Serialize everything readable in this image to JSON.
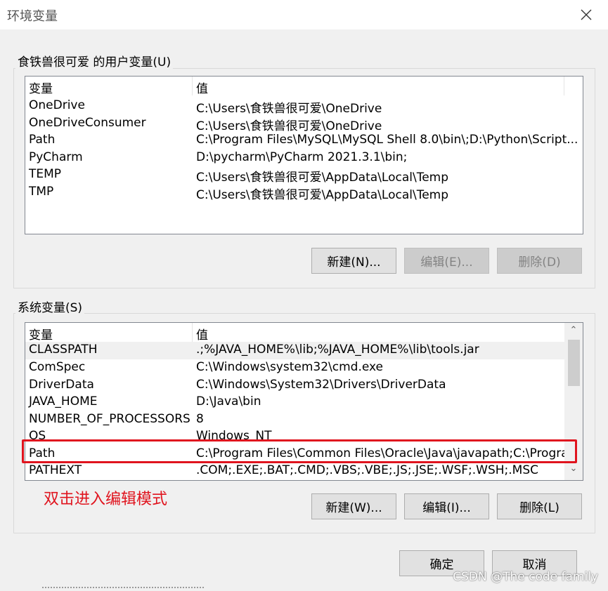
{
  "window": {
    "title": "环境变量"
  },
  "user_vars": {
    "group_label": "食铁兽很可爱 的用户变量(U)",
    "col_name": "变量",
    "col_value": "值",
    "rows": [
      {
        "name": "OneDrive",
        "value": "C:\\Users\\食铁兽很可爱\\OneDrive"
      },
      {
        "name": "OneDriveConsumer",
        "value": "C:\\Users\\食铁兽很可爱\\OneDrive"
      },
      {
        "name": "Path",
        "value": "C:\\Program Files\\MySQL\\MySQL Shell 8.0\\bin\\;D:\\Python\\Script..."
      },
      {
        "name": "PyCharm",
        "value": "D:\\pycharm\\PyCharm 2021.3.1\\bin;"
      },
      {
        "name": "TEMP",
        "value": "C:\\Users\\食铁兽很可爱\\AppData\\Local\\Temp"
      },
      {
        "name": "TMP",
        "value": "C:\\Users\\食铁兽很可爱\\AppData\\Local\\Temp"
      }
    ],
    "buttons": {
      "new": "新建(N)...",
      "edit": "编辑(E)...",
      "delete": "删除(D)"
    }
  },
  "system_vars": {
    "group_label": "系统变量(S)",
    "col_name": "变量",
    "col_value": "值",
    "rows": [
      {
        "name": "CLASSPATH",
        "value": ".;%JAVA_HOME%\\lib;%JAVA_HOME%\\lib\\tools.jar"
      },
      {
        "name": "ComSpec",
        "value": "C:\\Windows\\system32\\cmd.exe"
      },
      {
        "name": "DriverData",
        "value": "C:\\Windows\\System32\\Drivers\\DriverData"
      },
      {
        "name": "JAVA_HOME",
        "value": "D:\\Java\\bin"
      },
      {
        "name": "NUMBER_OF_PROCESSORS",
        "value": "8"
      },
      {
        "name": "OS",
        "value": "Windows_NT"
      },
      {
        "name": "Path",
        "value": "C:\\Program Files\\Common Files\\Oracle\\Java\\javapath;C:\\Progra..."
      },
      {
        "name": "PATHEXT",
        "value": ".COM;.EXE;.BAT;.CMD;.VBS;.VBE;.JS;.JSE;.WSF;.WSH;.MSC"
      }
    ],
    "buttons": {
      "new": "新建(W)...",
      "edit": "编辑(I)...",
      "delete": "删除(L)"
    }
  },
  "annotation": "双击进入编辑模式",
  "dialog_buttons": {
    "ok": "确定",
    "cancel": "取消"
  },
  "watermark": "CSDN @The code family",
  "colors": {
    "annotation": "#e0141e",
    "selected_row": "#f0f0f0"
  }
}
